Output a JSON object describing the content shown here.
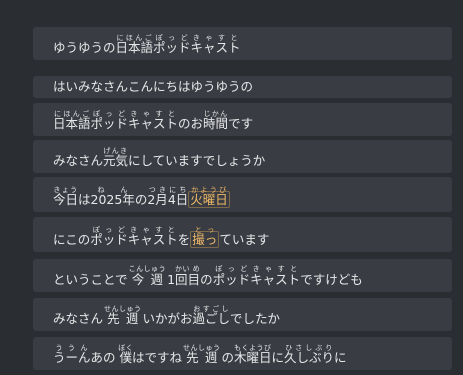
{
  "subtitles": [
    {
      "pre": "ゆうゆうの",
      "r1_base": "日本語",
      "r1_rt": "にほんご",
      "r2_base": "ポッドキャスト",
      "r2_rt": "ぽっどきゃすと"
    },
    {
      "text": "はいみなさんこんにちはゆうゆうの"
    },
    {
      "r1_base": "日本語",
      "r1_rt": "にほんご",
      "r2_base": "ポッドキャスト",
      "r2_rt": "ぽっどきゃすと",
      "mid": "のお",
      "r3_base": "時間",
      "r3_rt": "じかん",
      "post": "です"
    },
    {
      "pre": "みなさん",
      "r1_base": "元気",
      "r1_rt": "げんき",
      "post": "にしていますでしょうか"
    },
    {
      "r1_base": "今日",
      "r1_rt": "きょう",
      "mid1": "は",
      "r2_base": "2025年",
      "r2_rt": "ねん",
      "mid2": "の",
      "r3_base": "2月",
      "r3_rt": "つき",
      "r4_base": "4日",
      "r4_rt": "にち",
      "hl_base": "火曜日",
      "hl_rt": "かようび"
    },
    {
      "pre": "にこの",
      "r1_base": "ポッドキャスト",
      "r1_rt": "ぽっどきゃすと",
      "mid": "を",
      "hl_base": "撮っ",
      "hl_rt": "とっ",
      "post": "ています"
    },
    {
      "pre": "ということで ",
      "r1_base": "今週",
      "r1_rt": "こんしゅう",
      "mid1": " 1",
      "r2_base": "回目",
      "r2_rt": "かい め",
      "mid2": "の",
      "r3_base": "ポッドキャスト",
      "r3_rt": "ぽっどきゃすと",
      "post": "ですけども"
    },
    {
      "pre": "みなさん ",
      "r1_base": "先週",
      "r1_rt": "せんしゅう",
      "mid": " いかがお",
      "r2_base": "過ごし",
      "r2_rt": "おすごし",
      "post": "でしたか"
    },
    {
      "r1_base": "うーん",
      "r1_rt": "ううん",
      "mid1": "あの ",
      "r2_base": "僕",
      "r2_rt": "ぼく",
      "mid2": "はですね ",
      "r3_base": "先週",
      "r3_rt": "せんしゅう",
      "mid3": " の",
      "r4_base": "木曜日",
      "r4_rt": "もくようび",
      "mid4": "に",
      "r5_base": "久しぶり",
      "r5_rt": "ひさしぶり",
      "post": "に"
    }
  ]
}
